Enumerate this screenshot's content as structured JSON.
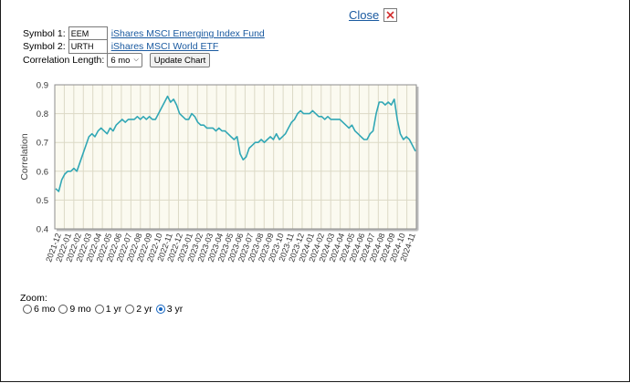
{
  "close": {
    "label": "Close"
  },
  "form": {
    "symbol1_label": "Symbol 1:",
    "symbol1_value": "EEM",
    "symbol1_name": "iShares MSCI Emerging Index Fund",
    "symbol2_label": "Symbol 2:",
    "symbol2_value": "URTH",
    "symbol2_name": "iShares MSCI World ETF",
    "length_label": "Correlation Length:",
    "length_value": "6 mo",
    "update_button": "Update Chart"
  },
  "zoom": {
    "title": "Zoom:",
    "options": [
      {
        "label": "6 mo",
        "selected": false
      },
      {
        "label": "9 mo",
        "selected": false
      },
      {
        "label": "1 yr",
        "selected": false
      },
      {
        "label": "2 yr",
        "selected": false
      },
      {
        "label": "3 yr",
        "selected": true
      }
    ]
  },
  "colors": {
    "line": "#31a7b5",
    "plot_bg": "#fbfaf0",
    "link": "#1a5aa0",
    "close_x": "#d32f2f"
  },
  "chart_data": {
    "type": "line",
    "ylabel": "Correlation",
    "ylim": [
      0.4,
      0.9
    ],
    "yticks": [
      0.4,
      0.5,
      0.6,
      0.7,
      0.8,
      0.9
    ],
    "grid": true,
    "categories": [
      "2021-12",
      "2022-01",
      "2022-02",
      "2022-03",
      "2022-04",
      "2022-05",
      "2022-06",
      "2022-07",
      "2022-08",
      "2022-09",
      "2022-10",
      "2022-11",
      "2022-12",
      "2023-01",
      "2023-02",
      "2023-03",
      "2023-04",
      "2023-05",
      "2023-06",
      "2023-07",
      "2023-08",
      "2023-09",
      "2023-10",
      "2023-11",
      "2023-12",
      "2024-01",
      "2024-02",
      "2024-03",
      "2024-04",
      "2024-05",
      "2024-06",
      "2024-07",
      "2024-08",
      "2024-09",
      "2024-10",
      "2024-11"
    ],
    "series": [
      {
        "values": [
          0.54,
          0.53,
          0.57,
          0.59,
          0.6,
          0.6,
          0.61,
          0.6,
          0.63,
          0.66,
          0.69,
          0.72,
          0.73,
          0.72,
          0.74,
          0.75,
          0.74,
          0.73,
          0.75,
          0.74,
          0.76,
          0.77,
          0.78,
          0.77,
          0.78,
          0.78,
          0.78,
          0.79,
          0.78,
          0.79,
          0.78,
          0.79,
          0.78,
          0.78,
          0.8,
          0.82,
          0.84,
          0.86,
          0.84,
          0.85,
          0.83,
          0.8,
          0.79,
          0.78,
          0.78,
          0.8,
          0.79,
          0.77,
          0.76,
          0.76,
          0.75,
          0.75,
          0.75,
          0.74,
          0.75,
          0.74,
          0.74,
          0.73,
          0.72,
          0.71,
          0.72,
          0.66,
          0.64,
          0.65,
          0.68,
          0.69,
          0.7,
          0.7,
          0.71,
          0.7,
          0.71,
          0.72,
          0.71,
          0.73,
          0.71,
          0.72,
          0.73,
          0.75,
          0.77,
          0.78,
          0.8,
          0.81,
          0.8,
          0.8,
          0.8,
          0.81,
          0.8,
          0.79,
          0.79,
          0.78,
          0.79,
          0.78,
          0.78,
          0.78,
          0.78,
          0.77,
          0.76,
          0.75,
          0.76,
          0.74,
          0.73,
          0.72,
          0.71,
          0.71,
          0.73,
          0.74,
          0.8,
          0.84,
          0.84,
          0.83,
          0.84,
          0.83,
          0.85,
          0.78,
          0.73,
          0.71,
          0.72,
          0.71,
          0.69,
          0.67
        ]
      }
    ]
  }
}
